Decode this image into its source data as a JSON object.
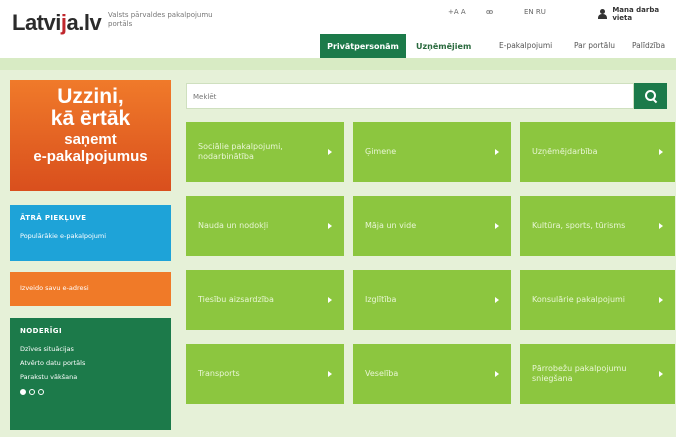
{
  "header": {
    "logo": {
      "text": "Latvi",
      "mark": "j",
      "suffix": "a.lv"
    },
    "tagline": "Valsts pārvaldes pakalpojumu portāls",
    "utility": {
      "font_size": "+A  A",
      "accessibility": "ꙭ",
      "languages": "EN  RU"
    },
    "user_link": "Mana darba vieta",
    "tabs": [
      "Privātpersonām",
      "Uzņēmējiem"
    ],
    "links": [
      "E-pakalpojumi",
      "Par portālu",
      "Palīdzība"
    ]
  },
  "sidebar": {
    "promo": {
      "line1": "Uzzini,",
      "line2": "kā ērtāk",
      "line3": "saņemt",
      "line4": "e-pakalpojumus"
    },
    "quick_access": {
      "title": "ĀTRĀ PIEKĻUVE",
      "link": "Populārākie e-pakalpojumi"
    },
    "email_box": "Izveido savu e-adresi",
    "useful": {
      "title": "NODERĪGI",
      "items": [
        "Dzīves situācijas",
        "Atvērto datu portāls",
        "Parakstu vākšana"
      ]
    }
  },
  "search": {
    "placeholder": "Meklēt"
  },
  "tiles": [
    [
      "Sociālie pakalpojumi, nodarbinātība",
      "Ģimene",
      "Uzņēmējdarbība"
    ],
    [
      "Nauda un nodokļi",
      "Māja un vide",
      "Kultūra, sports, tūrisms"
    ],
    [
      "Tiesību aizsardzība",
      "Izglītība",
      "Konsulārie pakalpojumi"
    ],
    [
      "Transports",
      "Veselība",
      "Pārrobežu pakalpojumu sniegšana"
    ]
  ],
  "colors": {
    "brand_green": "#1c7a4a",
    "tile_green": "#8cc63f",
    "orange": "#f07a28",
    "blue": "#1ea3d8",
    "background": "#e6f1d8"
  },
  "icons": {
    "search": "search-icon",
    "user": "user-icon",
    "tile_arrow": "chevron-right-icon"
  }
}
